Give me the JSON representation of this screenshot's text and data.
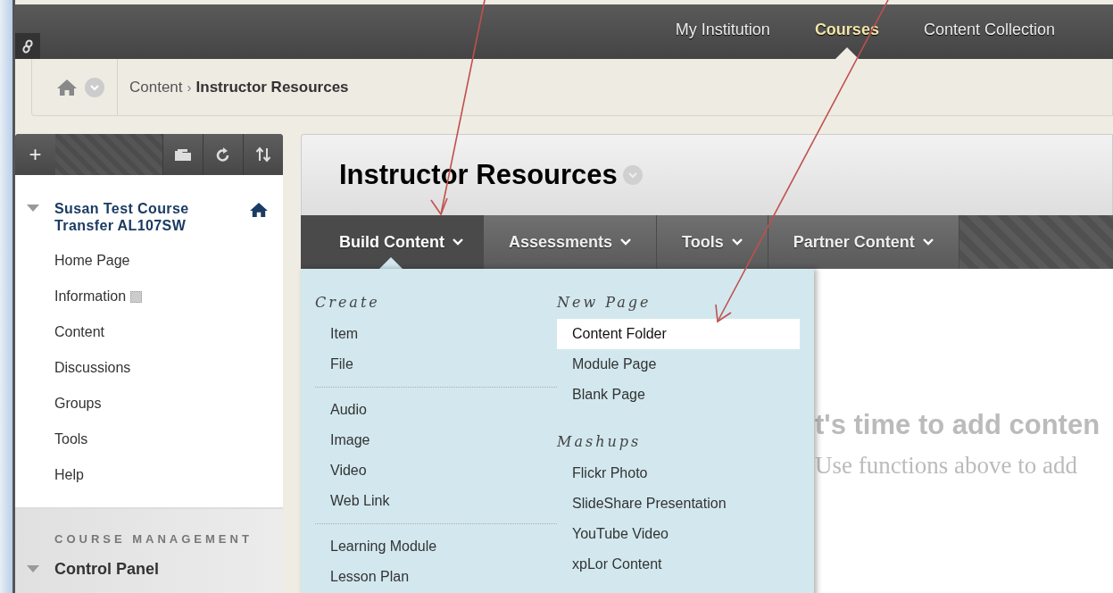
{
  "top_nav": {
    "items": [
      {
        "label": "My Institution",
        "selected": false
      },
      {
        "label": "Courses",
        "selected": true
      },
      {
        "label": "Content Collection",
        "selected": false
      }
    ]
  },
  "breadcrumb": {
    "separator": "›",
    "items": [
      {
        "label": "Content",
        "current": false
      },
      {
        "label": "Instructor Resources",
        "current": true
      }
    ]
  },
  "sidebar": {
    "toolbar": {
      "add": "+"
    },
    "course": {
      "title": "Susan Test Course Transfer AL107SW",
      "expanded": true
    },
    "items": [
      {
        "label": "Home Page",
        "kind": "link"
      },
      {
        "label": "Information",
        "kind": "link-with-icon"
      },
      {
        "label": "Content",
        "kind": "link"
      },
      {
        "label": "Discussions",
        "kind": "link"
      },
      {
        "label": "Groups",
        "kind": "link"
      },
      {
        "label": "Tools",
        "kind": "link"
      },
      {
        "label": "Help",
        "kind": "link"
      }
    ],
    "management": {
      "heading": "COURSE MANAGEMENT",
      "panel": {
        "label": "Control Panel",
        "expanded": true
      }
    }
  },
  "main": {
    "title": "Instructor Resources",
    "tabs": [
      {
        "label": "Build Content",
        "selected": true
      },
      {
        "label": "Assessments",
        "selected": false
      },
      {
        "label": "Tools",
        "selected": false
      },
      {
        "label": "Partner Content",
        "selected": false
      }
    ],
    "menu": {
      "columns": [
        {
          "sections": [
            {
              "heading": "Create",
              "groups": [
                [
                  {
                    "label": "Item",
                    "selected": false
                  },
                  {
                    "label": "File",
                    "selected": false
                  }
                ],
                [
                  {
                    "label": "Audio",
                    "selected": false
                  },
                  {
                    "label": "Image",
                    "selected": false
                  },
                  {
                    "label": "Video",
                    "selected": false
                  },
                  {
                    "label": "Web Link",
                    "selected": false
                  }
                ],
                [
                  {
                    "label": "Learning Module",
                    "selected": false
                  },
                  {
                    "label": "Lesson Plan",
                    "selected": false
                  }
                ]
              ]
            }
          ]
        },
        {
          "sections": [
            {
              "heading": "New Page",
              "groups": [
                [
                  {
                    "label": "Content Folder",
                    "selected": true
                  },
                  {
                    "label": "Module Page",
                    "selected": false
                  },
                  {
                    "label": "Blank Page",
                    "selected": false
                  }
                ]
              ]
            },
            {
              "heading": "Mashups",
              "groups": [
                [
                  {
                    "label": "Flickr Photo",
                    "selected": false
                  },
                  {
                    "label": "SlideShare Presentation",
                    "selected": false
                  },
                  {
                    "label": "YouTube Video",
                    "selected": false
                  },
                  {
                    "label": "xpLor Content",
                    "selected": false
                  }
                ]
              ]
            }
          ]
        }
      ]
    },
    "empty_state": {
      "heading": "t's time to add conten",
      "text": "Use functions above to add"
    }
  }
}
